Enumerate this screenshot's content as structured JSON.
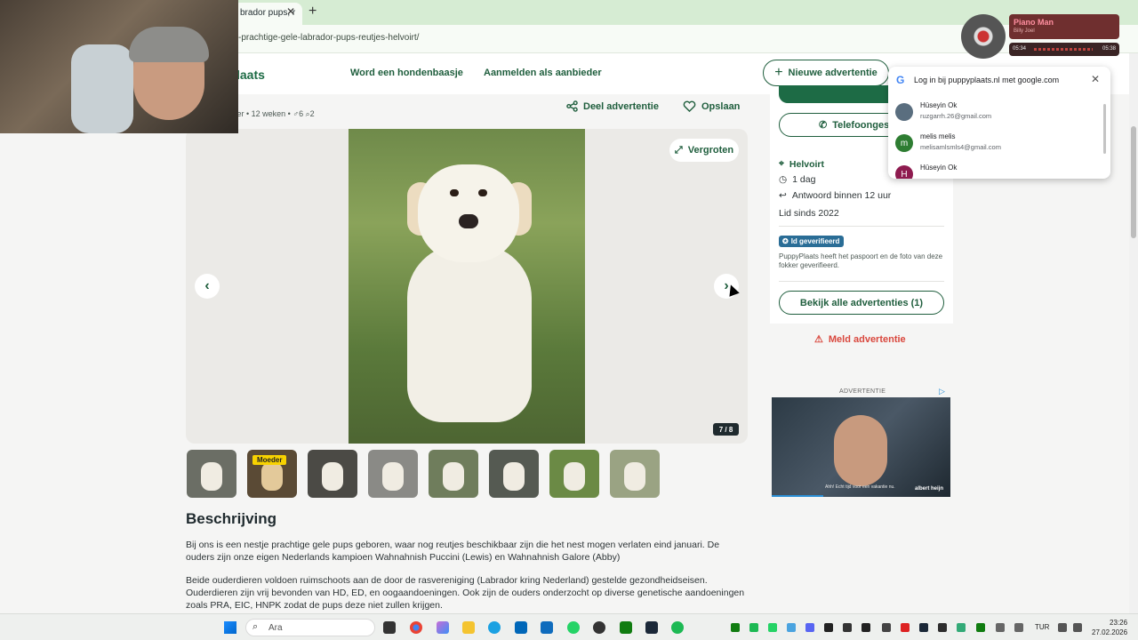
{
  "browser": {
    "tab_title": "brador pups, r",
    "url": "-prachtige-gele-labrador-pups-reutjes-helvoirt/"
  },
  "header": {
    "logo_text": "laats",
    "nav": [
      "Word een hondenbaasje",
      "Aanmelden als aanbieder"
    ],
    "new_ad_label": "Nieuwe advertentie"
  },
  "listing": {
    "meta": "ver • 12 weken • ♂6  ⌕2",
    "share_label": "Deel advertentie",
    "save_label": "Opslaan",
    "zoom_label": "Vergroten",
    "photo_counter": "7 / 8",
    "mother_badge": "Moeder",
    "description_title": "Beschrijving",
    "description": [
      "Bij ons is een nestje prachtige gele pups geboren, waar nog reutjes beschikbaar zijn die het nest mogen verlaten eind januari. De ouders zijn onze eigen Nederlands kampioen Wahnahnish Puccini (Lewis) en Wahnahnish Galore (Abby)",
      "Beide ouderdieren voldoen ruimschoots aan de door de rasvereniging (Labrador kring Nederland) gestelde gezondheidseisen. Ouderdieren zijn vrij bevonden van HD, ED, en oogaandoeningen. Ook zijn de ouders onderzocht op diverse genetische aandoeningen zoals PRA, EIC, HNPK zodat de pups deze niet zullen krijgen."
    ]
  },
  "seller": {
    "phone_label": "Telefoongesp",
    "location": "Helvoirt",
    "active": "1 dag",
    "response": "Antwoord binnen 12 uur",
    "member_since": "Lid sinds  2022",
    "verified_badge": "Id geverifieerd",
    "verified_note": "PuppyPlaats heeft het paspoort en de foto van deze fokker geverifieerd.",
    "all_ads_label": "Bekijk alle advertenties (1)",
    "report_label": "Meld advertentie"
  },
  "ad": {
    "label": "ADVERTENTIE",
    "caption": "Ahh! Echt tijd voor een vakantie nu.",
    "logo": "albert heijn"
  },
  "google_popup": {
    "title": "Log in bij puppyplaats.nl met google.com",
    "accounts": [
      {
        "name": "Hüseyin Ok",
        "email": "ruzgarrh.26@gmail.com",
        "initial": "",
        "color": "#5a6e7f"
      },
      {
        "name": "melis melis",
        "email": "melisamlsmls4@gmail.com",
        "initial": "m",
        "color": "#2e7d32"
      },
      {
        "name": "Hüseyin Ok",
        "email": "",
        "initial": "H",
        "color": "#8e1b4f"
      }
    ]
  },
  "music": {
    "title": "Piano Man",
    "artist": "Billy Joel",
    "elapsed": "05:34",
    "total": "05:38"
  },
  "taskbar": {
    "search_placeholder": "Ara",
    "language": "TUR",
    "time": "23:26",
    "date": "27.02.2026"
  }
}
